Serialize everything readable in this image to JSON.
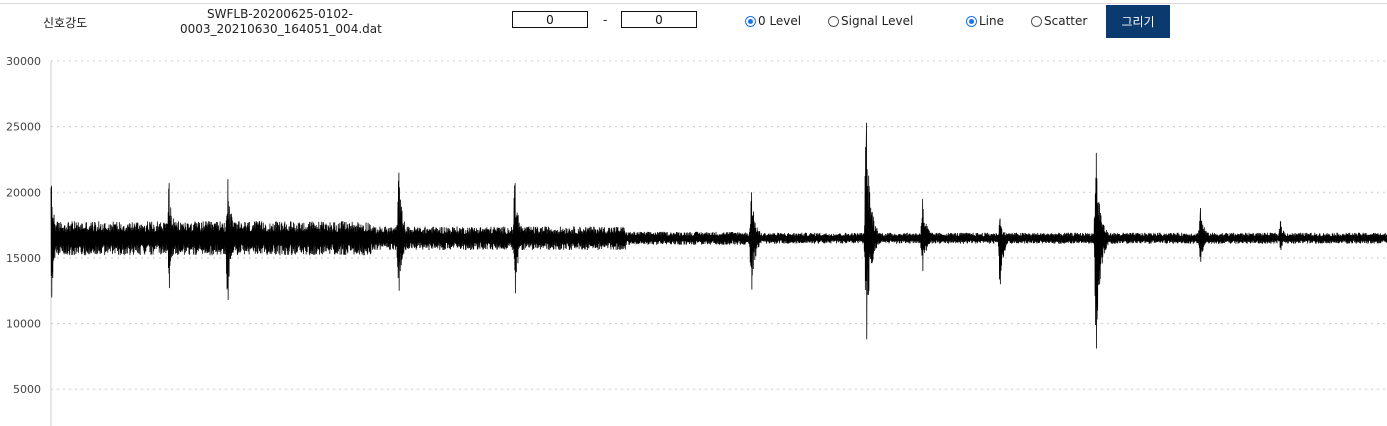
{
  "toolbar": {
    "title": "신호강도",
    "filename_line1": "SWFLB-20200625-0102-",
    "filename_line2": "0003_20210630_164051_004.dat",
    "range_start": "0",
    "range_separator": "-",
    "range_end": "0",
    "level_options": [
      {
        "label": "0 Level",
        "checked": true
      },
      {
        "label": "Signal Level",
        "checked": false
      }
    ],
    "type_options": [
      {
        "label": "Line",
        "checked": true
      },
      {
        "label": "Scatter",
        "checked": false
      }
    ],
    "draw_button": "그리기"
  },
  "colors": {
    "line": "#000000",
    "grid": "#cccccc",
    "button": "#0b3a6e",
    "radio_checked": "#1a73e8"
  },
  "chart_data": {
    "type": "line",
    "title": "",
    "xlabel": "",
    "ylabel": "",
    "ylim": [
      2200,
      30000
    ],
    "yticks": [
      5000,
      10000,
      15000,
      20000,
      25000,
      30000
    ],
    "grid": "horizontal dotted",
    "baseline": 16500,
    "x_range": [
      0,
      1000
    ],
    "noise_segments": [
      {
        "x0": 0,
        "x1": 240,
        "amplitude": 1300
      },
      {
        "x0": 240,
        "x1": 430,
        "amplitude": 900
      },
      {
        "x0": 430,
        "x1": 520,
        "amplitude": 500
      },
      {
        "x0": 520,
        "x1": 1000,
        "amplitude": 420
      }
    ],
    "bursts": [
      {
        "x": 0,
        "max": 20500,
        "min": 12000
      },
      {
        "x": 88,
        "max": 20700,
        "min": 12700
      },
      {
        "x": 132,
        "max": 21000,
        "min": 11800
      },
      {
        "x": 260,
        "max": 21500,
        "min": 12500
      },
      {
        "x": 347,
        "max": 20700,
        "min": 12300
      },
      {
        "x": 524,
        "max": 20000,
        "min": 12600
      },
      {
        "x": 610,
        "max": 25300,
        "min": 8800
      },
      {
        "x": 652,
        "max": 19500,
        "min": 14000
      },
      {
        "x": 710,
        "max": 18000,
        "min": 13000
      },
      {
        "x": 782,
        "max": 23000,
        "min": 8100
      },
      {
        "x": 860,
        "max": 18800,
        "min": 14700
      },
      {
        "x": 920,
        "max": 17800,
        "min": 15600
      }
    ]
  }
}
